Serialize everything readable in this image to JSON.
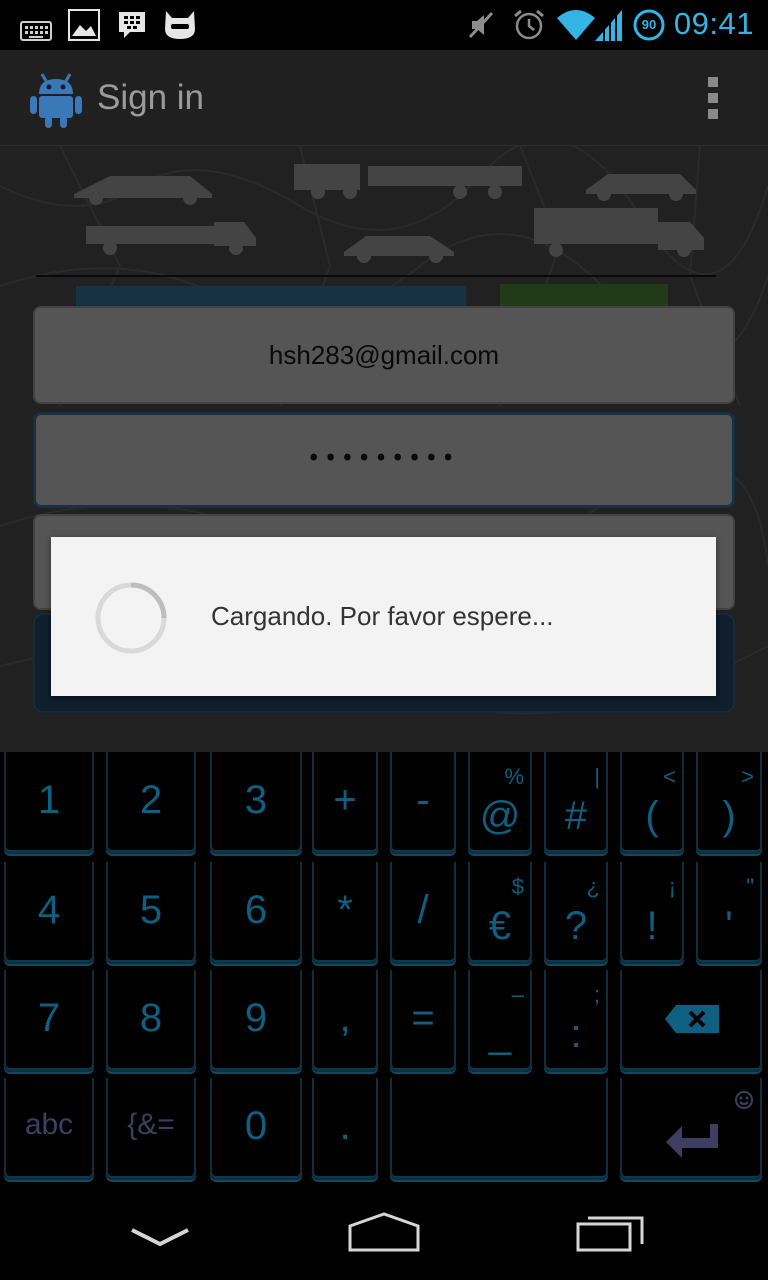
{
  "status_bar": {
    "time": "09:41",
    "battery_level": "90",
    "icons": [
      "keyboard-icon",
      "gallery-icon",
      "bbm-icon",
      "cyanogen-icon",
      "mute-icon",
      "alarm-icon",
      "wifi-icon",
      "signal-icon",
      "battery-icon"
    ]
  },
  "action_bar": {
    "title": "Sign in",
    "app_icon": "android-robot-icon"
  },
  "form": {
    "email_value": "hsh283@gmail.com",
    "password_mask": "•••••••••"
  },
  "dialog": {
    "message": "Cargando. Por favor espere..."
  },
  "keyboard": {
    "row1": [
      {
        "main": "1"
      },
      {
        "main": "2"
      },
      {
        "main": "3"
      },
      {
        "main": "+"
      },
      {
        "main": "-"
      },
      {
        "main": "@",
        "sup": "%"
      },
      {
        "main": "#",
        "sup": "|"
      },
      {
        "main": "(",
        "sup": "<"
      },
      {
        "main": ")",
        "sup": ">"
      }
    ],
    "row2": [
      {
        "main": "4"
      },
      {
        "main": "5"
      },
      {
        "main": "6"
      },
      {
        "main": "*"
      },
      {
        "main": "/"
      },
      {
        "main": "€",
        "sup": "$"
      },
      {
        "main": "?",
        "sup": "¿"
      },
      {
        "main": "!",
        "sup": "¡"
      },
      {
        "main": "'",
        "sup": "\""
      }
    ],
    "row3": [
      {
        "main": "7"
      },
      {
        "main": "8"
      },
      {
        "main": "9"
      },
      {
        "main": ","
      },
      {
        "main": "="
      },
      {
        "main": "_",
        "sup": "–"
      },
      {
        "main": ":",
        "sup": ";"
      }
    ],
    "row4": [
      {
        "main": "abc"
      },
      {
        "main": "{&="
      },
      {
        "main": "0"
      },
      {
        "main": "."
      }
    ],
    "backspace": "backspace-icon",
    "enter": "enter-icon",
    "smiley": "smiley-icon"
  },
  "nav_bar": {
    "icons": [
      "back-icon",
      "home-icon",
      "recents-icon"
    ]
  }
}
